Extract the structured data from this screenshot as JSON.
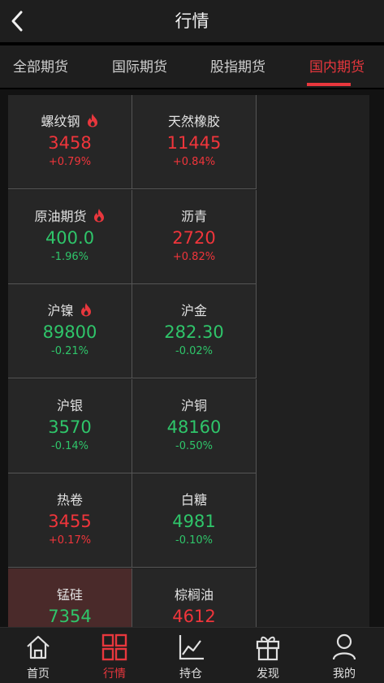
{
  "header": {
    "title": "行情"
  },
  "tabs": [
    {
      "label": "全部期货"
    },
    {
      "label": "国际期货"
    },
    {
      "label": "股指期货"
    },
    {
      "label": "国内期货"
    }
  ],
  "colors": {
    "up": "#f0353b",
    "down": "#2fc56a",
    "accent": "#e8373d"
  },
  "quotes": [
    {
      "name": "螺纹钢",
      "price": "3458",
      "change": "+0.79%",
      "direction": "up",
      "hot": true
    },
    {
      "name": "天然橡胶",
      "price": "11445",
      "change": "+0.84%",
      "direction": "up",
      "hot": false
    },
    {
      "name": "原油期货",
      "price": "400.0",
      "change": "-1.96%",
      "direction": "down",
      "hot": true
    },
    {
      "name": "沥青",
      "price": "2720",
      "change": "+0.82%",
      "direction": "up",
      "hot": false
    },
    {
      "name": "沪镍",
      "price": "89800",
      "change": "-0.21%",
      "direction": "down",
      "hot": true
    },
    {
      "name": "沪金",
      "price": "282.30",
      "change": "-0.02%",
      "direction": "down",
      "hot": false
    },
    {
      "name": "沪银",
      "price": "3570",
      "change": "-0.14%",
      "direction": "down",
      "hot": false
    },
    {
      "name": "沪铜",
      "price": "48160",
      "change": "-0.50%",
      "direction": "down",
      "hot": false
    },
    {
      "name": "热卷",
      "price": "3455",
      "change": "+0.17%",
      "direction": "up",
      "hot": false
    },
    {
      "name": "白糖",
      "price": "4981",
      "change": "-0.10%",
      "direction": "down",
      "hot": false
    },
    {
      "name": "锰硅",
      "price": "7354",
      "change": "",
      "direction": "down",
      "hot": false
    },
    {
      "name": "棕榈油",
      "price": "4612",
      "change": "",
      "direction": "up",
      "hot": false
    }
  ],
  "bottom_nav": [
    {
      "label": "首页",
      "icon": "home-icon"
    },
    {
      "label": "行情",
      "icon": "grid-icon"
    },
    {
      "label": "持仓",
      "icon": "chart-line-icon"
    },
    {
      "label": "发现",
      "icon": "gift-icon"
    },
    {
      "label": "我的",
      "icon": "user-icon"
    }
  ]
}
